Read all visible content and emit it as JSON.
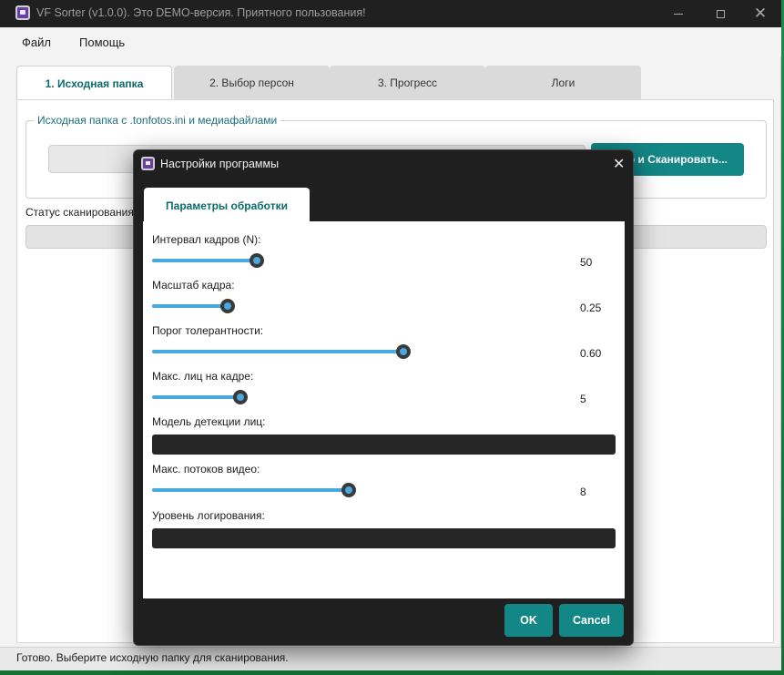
{
  "window": {
    "title": "VF Sorter (v1.0.0). Это DEMO-версия. Приятного пользования!",
    "minimize": "",
    "close": "✕"
  },
  "menu": {
    "file": "Файл",
    "help": "Помощь"
  },
  "tabs": [
    {
      "label": "1. Исходная папка",
      "active": true
    },
    {
      "label": "2. Выбор персон",
      "active": false
    },
    {
      "label": "3. Прогресс",
      "active": false
    },
    {
      "label": "Логи",
      "active": false
    }
  ],
  "source": {
    "group_title": "Исходная папка с .tonfotos.ini и медиафайлами",
    "path_value": "",
    "scan_button": "р и Сканировать..."
  },
  "status": {
    "label": "Статус сканирования:",
    "progress": 0
  },
  "statusbar": {
    "text": "Готово. Выберите исходную папку для сканирования."
  },
  "dialog": {
    "title": "Настройки программы",
    "close": "✕",
    "tab": "Параметры обработки",
    "params": [
      {
        "label": "Интервал кадров (N):",
        "value": "50",
        "fraction": 0.25
      },
      {
        "label": "Масштаб кадра:",
        "value": "0.25",
        "fraction": 0.18
      },
      {
        "label": "Порог толерантности:",
        "value": "0.60",
        "fraction": 0.6
      },
      {
        "label": "Макс. лиц на кадре:",
        "value": "5",
        "fraction": 0.21
      },
      {
        "label": "Модель детекции лиц:",
        "value": ""
      },
      {
        "label": "Макс. потоков видео:",
        "value": "8",
        "fraction": 0.47
      },
      {
        "label": "Уровень логирования:",
        "value": ""
      }
    ],
    "ok": "OK",
    "cancel": "Cancel"
  },
  "colors": {
    "accent": "#138686",
    "slider": "#4aa8e0",
    "dialog_bg": "#1f1f1f"
  }
}
